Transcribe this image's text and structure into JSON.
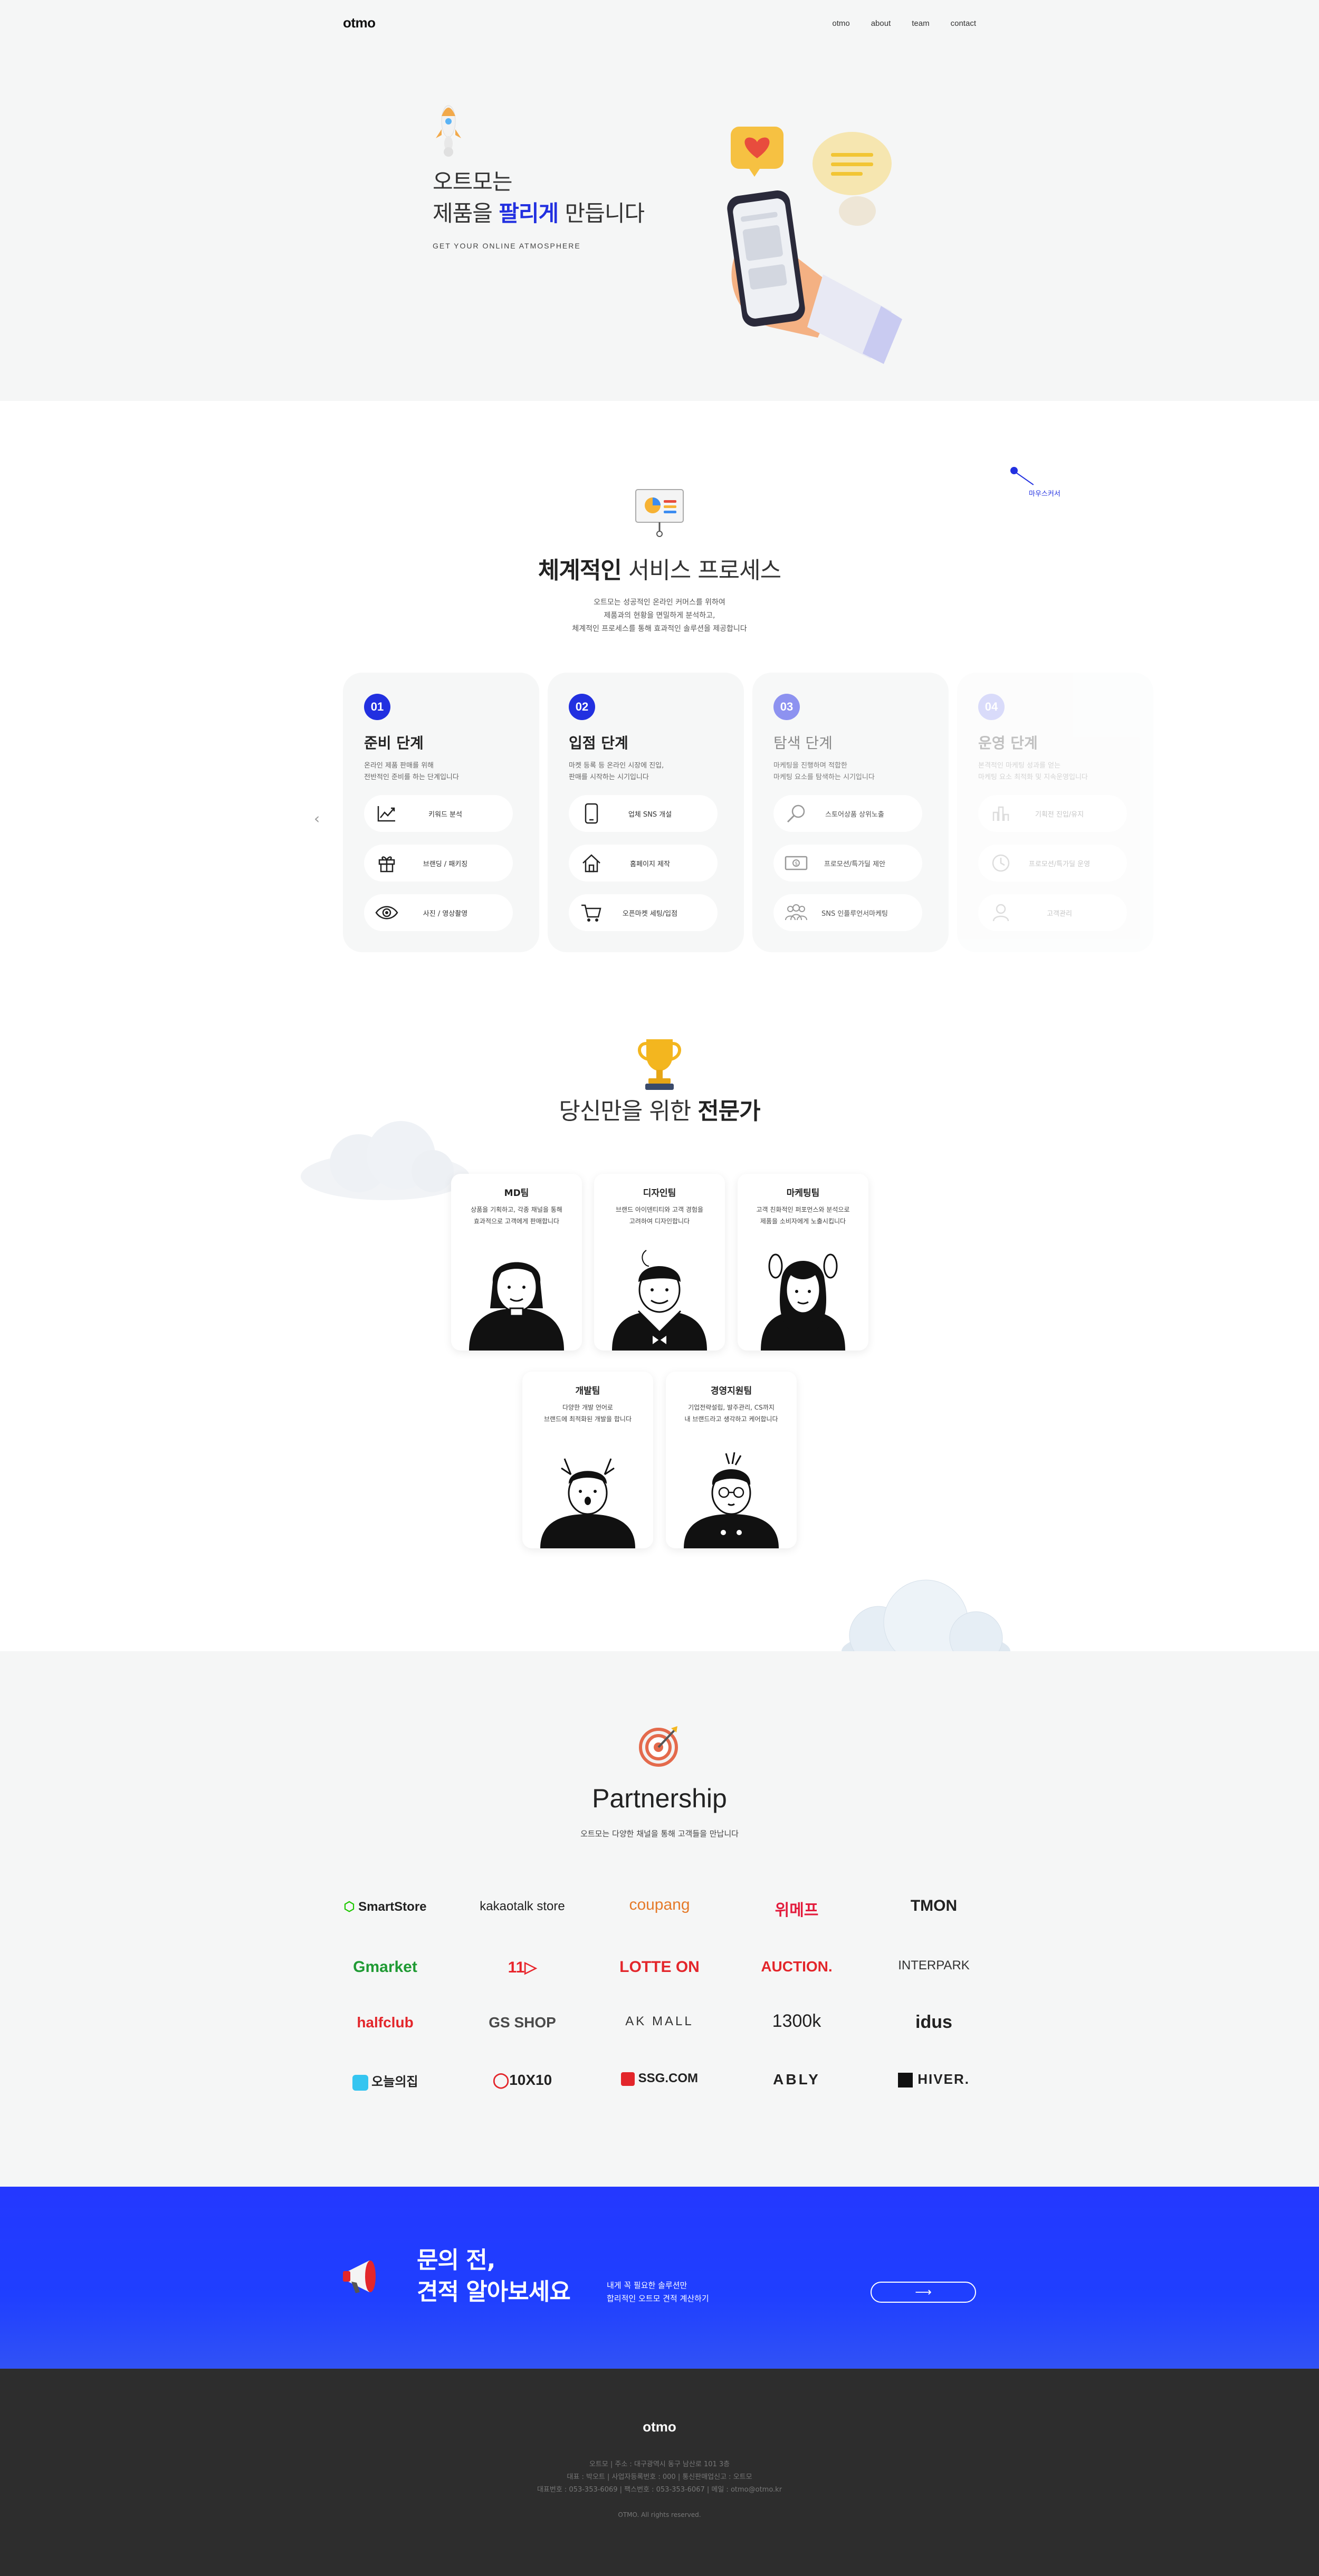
{
  "header": {
    "logo": "otmo",
    "nav": [
      "otmo",
      "about",
      "team",
      "contact"
    ]
  },
  "hero": {
    "title_line1": "오트모는",
    "title_line2_pre": "제품을 ",
    "title_line2_accent": "팔리게",
    "title_line2_post": " 만듭니다",
    "subtitle": "GET YOUR ONLINE ATMOSPHERE",
    "accent_color": "#2230e0"
  },
  "process": {
    "mouse_label": "마우스커서",
    "title_bold": "체계적인",
    "title_rest": " 서비스 프로세스",
    "desc": [
      "오트모는 성공적인 온라인 커머스를 위하여",
      "제품과의 현황을 면밀하게 분석하고,",
      "체계적인 프로세스를 통해 효과적인 솔루션을 제공합니다"
    ],
    "prev_arrow": "‹",
    "cards": [
      {
        "num": "01",
        "title": "준비 단계",
        "desc": [
          "온라인 제품 판매를 위해",
          "전반적인 준비를 하는 단계입니다"
        ],
        "items": [
          {
            "icon": "chart-line-icon",
            "label": "키워드 분석"
          },
          {
            "icon": "gift-icon",
            "label": "브랜딩 / 패키징"
          },
          {
            "icon": "eye-icon",
            "label": "사진 / 영상촬영"
          }
        ]
      },
      {
        "num": "02",
        "title": "입점 단계",
        "desc": [
          "마켓 등록 등 온라인 시장에 진입,",
          "판매를 시작하는 시기입니다"
        ],
        "items": [
          {
            "icon": "phone-icon",
            "label": "업체 SNS 개설"
          },
          {
            "icon": "home-icon",
            "label": "홈페이지 제작"
          },
          {
            "icon": "cart-icon",
            "label": "오픈마켓 세팅/입점"
          }
        ]
      },
      {
        "num": "03",
        "title": "탐색 단계",
        "desc": [
          "마케팅을 진행하며 적합한",
          "마케팅 요소를 탐색하는 시기입니다"
        ],
        "items": [
          {
            "icon": "search-icon",
            "label": "스토어상품 상위노출"
          },
          {
            "icon": "money-icon",
            "label": "프로모션/특가딜 제안"
          },
          {
            "icon": "people-icon",
            "label": "SNS 인플루언서마케팅"
          }
        ]
      },
      {
        "num": "04",
        "title": "운영 단계",
        "desc": [
          "본격적인 마케팅 성과를 얻는",
          "마케팅 요소 최적화 및 지속운영입니다"
        ],
        "items": [
          {
            "icon": "bar-chart-icon",
            "label": "기획전 진입/유지"
          },
          {
            "icon": "clock-icon",
            "label": "프로모션/특가딜 운영"
          },
          {
            "icon": "user-icon",
            "label": "고객관리"
          }
        ]
      }
    ]
  },
  "experts": {
    "title_light": "당신만을 위한 ",
    "title_bold": "전문가",
    "teams": [
      {
        "name": "MD팀",
        "desc": [
          "상품을 기획하고, 각종 채널을 통해",
          "효과적으로 고객에게 판매합니다"
        ]
      },
      {
        "name": "디자인팀",
        "desc": [
          "브랜드 아이덴티티와 고객 경험을",
          "고려하여 디자인합니다"
        ]
      },
      {
        "name": "마케팅팀",
        "desc": [
          "고객 친화적인 퍼포먼스와 분석으로",
          "제품을 소비자에게 노출시킵니다"
        ]
      },
      {
        "name": "개발팀",
        "desc": [
          "다양한 개발 언어로",
          "브랜드에 최적화된 개발을 합니다"
        ]
      },
      {
        "name": "경영지원팀",
        "desc": [
          "기업전략설립, 발주관리, CS까지",
          "내 브랜드라고 생각하고 케어합니다"
        ]
      }
    ]
  },
  "partnership": {
    "title": "Partnership",
    "desc": "오트모는 다양한 채널을 통해 고객들을 만납니다",
    "brands": [
      {
        "name": "SmartStore",
        "color": "#1b1b1b",
        "icon": "smartstore-icon"
      },
      {
        "name": "kakaotalk store",
        "color": "#1b1b1b"
      },
      {
        "name": "coupang",
        "color": "#e57a2a"
      },
      {
        "name": "위메프",
        "color": "#e31b3c"
      },
      {
        "name": "TMON",
        "color": "#1b1b1b"
      },
      {
        "name": "Gmarket",
        "color": "#1f9a33"
      },
      {
        "name": "11번가",
        "display": "11▷",
        "color": "#e8252c"
      },
      {
        "name": "LOTTE ON",
        "color": "#e3262b"
      },
      {
        "name": "AUCTION.",
        "color": "#e3262b"
      },
      {
        "name": "INTERPARK",
        "color": "#333333"
      },
      {
        "name": "halfclub",
        "color": "#e3262b"
      },
      {
        "name": "GS SHOP",
        "color": "#4a4a4a"
      },
      {
        "name": "AK MALL",
        "color": "#333333"
      },
      {
        "name": "1300k",
        "color": "#1b1b1b"
      },
      {
        "name": "idus",
        "color": "#1b1b1b"
      },
      {
        "name": "오늘의집",
        "color": "#1b1b1b"
      },
      {
        "name": "10X10",
        "color": "#1b1b1b"
      },
      {
        "name": "SSG.COM",
        "color": "#1b1b1b"
      },
      {
        "name": "ABLY",
        "color": "#1b1b1b"
      },
      {
        "name": "HIVER.",
        "color": "#1b1b1b"
      }
    ]
  },
  "cta": {
    "title_line1": "문의 전,",
    "title_line2": "견적 알아보세요",
    "desc": [
      "내게 꼭 필요한 솔루션만",
      "합리적인 오트모 견적 계산하기"
    ],
    "button_arrow": "⟶",
    "bg_color": "#1f3fff"
  },
  "footer": {
    "logo": "otmo",
    "info": [
      "오트모 | 주소 : 대구광역시 동구 남산로 101 3층",
      "대표 : 박오트 | 사업자등록번호 : 000 | 통신판매업신고 : 오트모",
      "대표번호 : 053-353-6069 | 팩스번호 : 053-353-6067 | 메일 : otmo@otmo.kr"
    ],
    "copyright": "OTMO. All rights reserved."
  }
}
